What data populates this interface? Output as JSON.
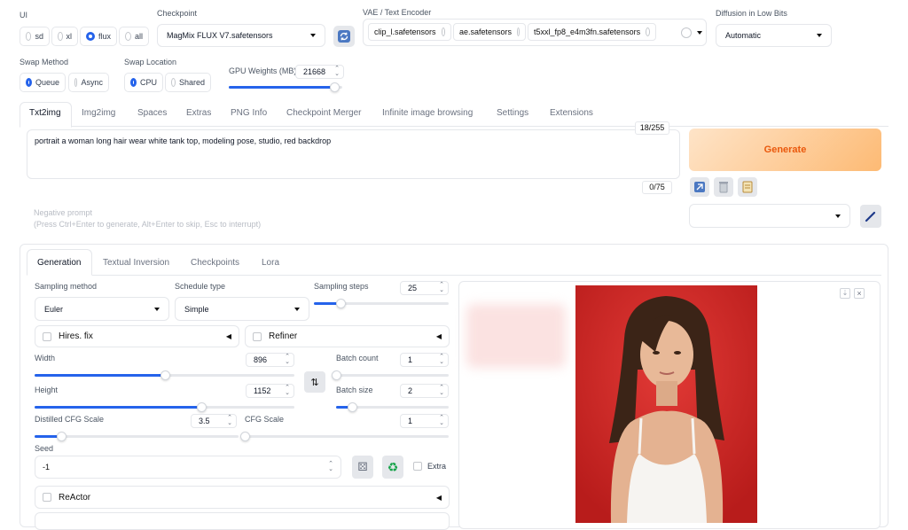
{
  "top": {
    "ui_label": "UI",
    "ui_options": [
      {
        "label": "sd",
        "selected": false
      },
      {
        "label": "xl",
        "selected": false
      },
      {
        "label": "flux",
        "selected": true
      },
      {
        "label": "all",
        "selected": false
      }
    ],
    "checkpoint_label": "Checkpoint",
    "checkpoint_value": "MagMix FLUX V7.safetensors",
    "vae_label": "VAE / Text Encoder",
    "vae_chips": [
      "clip_l.safetensors",
      "ae.safetensors",
      "t5xxl_fp8_e4m3fn.safetensors"
    ],
    "diffusion_label": "Diffusion in Low Bits",
    "diffusion_value": "Automatic",
    "swap_method_label": "Swap Method",
    "swap_method_options": [
      {
        "label": "Queue",
        "selected": true
      },
      {
        "label": "Async",
        "selected": false
      }
    ],
    "swap_location_label": "Swap Location",
    "swap_location_options": [
      {
        "label": "CPU",
        "selected": true
      },
      {
        "label": "Shared",
        "selected": false
      }
    ],
    "gpu_weights_label": "GPU Weights (MB)",
    "gpu_weights_value": "21668",
    "gpu_weights_fraction": 0.93
  },
  "main_tabs": [
    "Txt2img",
    "Img2img",
    "Spaces",
    "Extras",
    "PNG Info",
    "Checkpoint Merger",
    "Infinite image browsing",
    "Settings",
    "Extensions"
  ],
  "active_main_tab": "Txt2img",
  "prompt": {
    "text": "portrait a woman long hair wear white tank top, modeling pose,  studio, red backdrop",
    "token_count": "18/255",
    "negative_placeholder": "Negative prompt\n(Press Ctrl+Enter to generate, Alt+Enter to skip, Esc to interrupt)",
    "negative_count": "0/75"
  },
  "generate_label": "Generate",
  "sub_tabs": [
    "Generation",
    "Textual Inversion",
    "Checkpoints",
    "Lora"
  ],
  "gen": {
    "sampling_method_label": "Sampling method",
    "sampling_method_value": "Euler",
    "schedule_type_label": "Schedule type",
    "schedule_type_value": "Simple",
    "sampling_steps_label": "Sampling steps",
    "sampling_steps_value": "25",
    "sampling_steps_fraction": 0.2,
    "hires_label": "Hires. fix",
    "refiner_label": "Refiner",
    "width_label": "Width",
    "width_value": "896",
    "width_fraction": 0.5,
    "height_label": "Height",
    "height_value": "1152",
    "height_fraction": 0.64,
    "batch_count_label": "Batch count",
    "batch_count_value": "1",
    "batch_count_fraction": 0.0,
    "batch_size_label": "Batch size",
    "batch_size_value": "2",
    "batch_size_fraction": 0.14,
    "distilled_cfg_label": "Distilled CFG Scale",
    "distilled_cfg_value": "3.5",
    "distilled_cfg_fraction": 0.13,
    "cfg_label": "CFG Scale",
    "cfg_value": "1",
    "cfg_fraction": 0.0,
    "seed_label": "Seed",
    "seed_value": "-1",
    "extra_label": "Extra",
    "reactor_label": "ReActor"
  },
  "colors": {
    "accent": "#2563eb",
    "generate_gradient_start": "#fed7aa",
    "generate_gradient_end": "#fdba74",
    "generate_text": "#ea580c",
    "backdrop_red": "#d62a27"
  }
}
